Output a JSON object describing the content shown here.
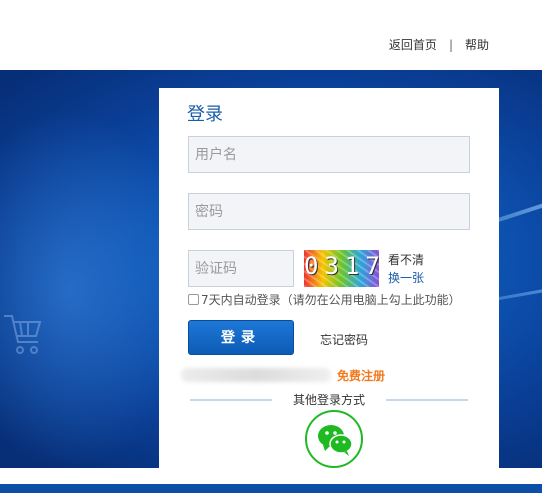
{
  "header": {
    "home_link": "返回首页",
    "separator": "|",
    "help_link": "帮助"
  },
  "login": {
    "title": "登录",
    "username_placeholder": "用户名",
    "password_placeholder": "密码",
    "captcha_placeholder": "验证码",
    "captcha_code": "0317",
    "captcha_hint": "看不清",
    "captcha_refresh": "换一张",
    "remember_label": "7天内自动登录（请勿在公用电脑上勾上此功能）",
    "submit_label": "登录",
    "forgot_label": "忘记密码",
    "register_label": "免费注册",
    "other_methods_label": "其他登录方式"
  },
  "icons": {
    "wechat": "wechat-icon",
    "cart": "cart-icon"
  },
  "colors": {
    "accent": "#1a5ea8",
    "register": "#f27b1f",
    "wechat": "#1fb922",
    "banner": "#0e58b8"
  }
}
